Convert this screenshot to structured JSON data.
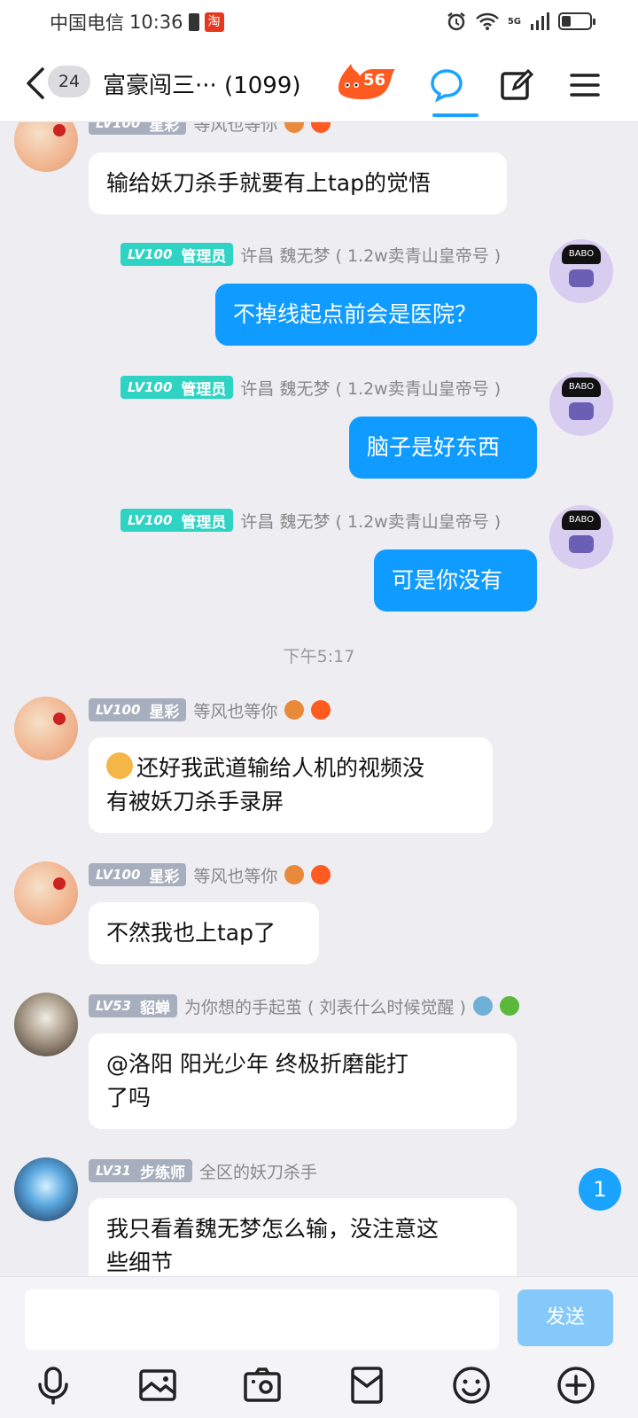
{
  "status_bar": {
    "carrier": "中国电信",
    "time": "10:36",
    "app_badge": "淘",
    "network": "5G"
  },
  "header": {
    "unread_count": "24",
    "title": "富豪闯三···  (1099)",
    "streak": "56"
  },
  "messages": [
    {
      "side": "in",
      "level": "LV100",
      "role": "星彩",
      "nickname": "等风也等你",
      "text": "输给妖刀杀手就要有上tap的觉悟"
    },
    {
      "side": "out",
      "level": "LV100",
      "role": "管理员",
      "nickname": "许昌  魏无梦 ( 1.2w卖青山皇帝号 )",
      "text": "不掉线起点前会是医院？"
    },
    {
      "side": "out",
      "level": "LV100",
      "role": "管理员",
      "nickname": "许昌  魏无梦 ( 1.2w卖青山皇帝号 )",
      "text": "脑子是好东西"
    },
    {
      "side": "out",
      "level": "LV100",
      "role": "管理员",
      "nickname": "许昌  魏无梦 ( 1.2w卖青山皇帝号 )",
      "text": "可是你没有"
    },
    {
      "side": "in",
      "level": "LV100",
      "role": "星彩",
      "nickname": "等风也等你",
      "text_line1": "还好我武道输给人机的视频没",
      "text_line2": "有被妖刀杀手录屏"
    },
    {
      "side": "in",
      "level": "LV100",
      "role": "星彩",
      "nickname": "等风也等你",
      "text": "不然我也上tap了"
    },
    {
      "side": "in",
      "level": "LV53",
      "role": "貂蝉",
      "nickname": "为你想的手起茧 (  刘表什么时候觉醒 )",
      "text_line1": "@洛阳   阳光少年 终极折磨能打",
      "text_line2": "了吗"
    },
    {
      "side": "in",
      "level": "LV31",
      "role": "步练师",
      "nickname": "全区的妖刀杀手",
      "text_line1": "我只看着魏无梦怎么输，没注意这",
      "text_line2": "些细节"
    }
  ],
  "timestamp": "下午5:17",
  "floating_unread": "1",
  "input": {
    "placeholder": "",
    "send_label": "发送"
  },
  "toolbar": [
    "microphone-icon",
    "image-icon",
    "camera-icon",
    "red-packet-icon",
    "emoji-icon",
    "plus-icon"
  ],
  "colors": {
    "accent": "#0f9bff",
    "admin_badge": "#2ed3c3",
    "member_badge": "#a7aebd",
    "send_disabled": "#85c9fb"
  }
}
